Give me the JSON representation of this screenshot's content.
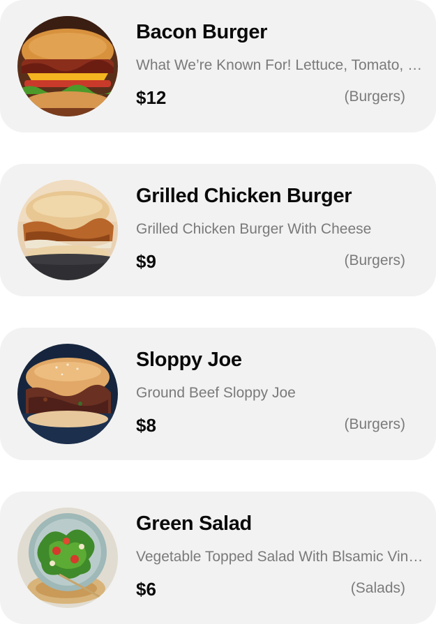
{
  "menu_items": [
    {
      "name": "Bacon Burger",
      "description": "What We’re Known For! Lettuce, Tomato, Bacon, Cheese",
      "price": "$12",
      "category": "(Burgers)",
      "image_icon": "bacon-burger-photo"
    },
    {
      "name": "Grilled Chicken Burger",
      "description": "Grilled Chicken Burger With Cheese",
      "price": "$9",
      "category": "(Burgers)",
      "image_icon": "chicken-burger-photo"
    },
    {
      "name": "Sloppy Joe",
      "description": "Ground Beef Sloppy Joe",
      "price": "$8",
      "category": "(Burgers)",
      "image_icon": "sloppy-joe-photo"
    },
    {
      "name": "Green Salad",
      "description": "Vegetable Topped Salad With Blsamic Vinaigrette",
      "price": "$6",
      "category": "(Salads)",
      "image_icon": "green-salad-photo"
    }
  ],
  "colors": {
    "card_background": "#f2f2f2",
    "title_text": "#0a0a0a",
    "secondary_text": "#7a7a7a"
  }
}
